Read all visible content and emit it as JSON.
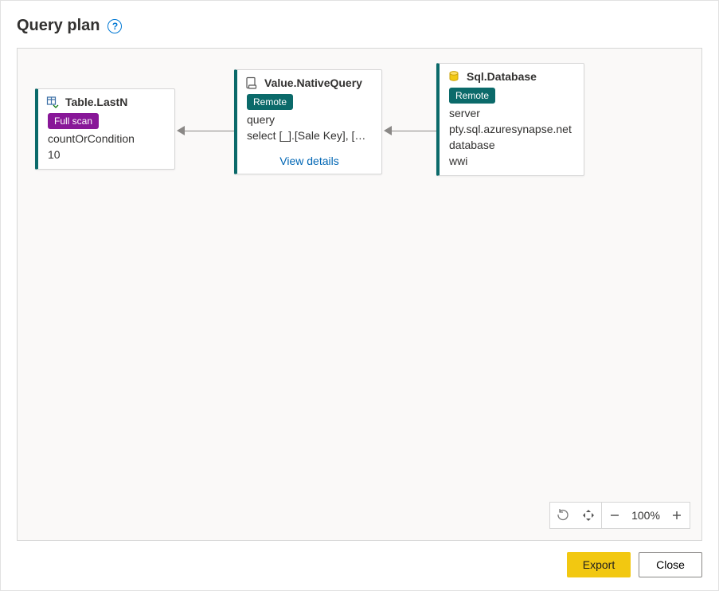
{
  "dialog": {
    "title": "Query plan",
    "help_tooltip": "?"
  },
  "nodes": {
    "tableLastN": {
      "title": "Table.LastN",
      "badge": "Full scan",
      "param_key": "countOrCondition",
      "param_value": "10"
    },
    "nativeQuery": {
      "title": "Value.NativeQuery",
      "badge": "Remote",
      "param_key": "query",
      "param_value": "select [_].[Sale Key], [_]....",
      "details_link": "View details"
    },
    "sqlDatabase": {
      "title": "Sql.Database",
      "badge": "Remote",
      "server_key": "server",
      "server_value": "pty.sql.azuresynapse.net",
      "database_key": "database",
      "database_value": "wwi"
    }
  },
  "toolbar": {
    "reset_label": "Reset",
    "fit_label": "Fit",
    "zoom_out_label": "Zoom out",
    "zoom_level": "100%",
    "zoom_in_label": "Zoom in"
  },
  "footer": {
    "export_label": "Export",
    "close_label": "Close"
  }
}
